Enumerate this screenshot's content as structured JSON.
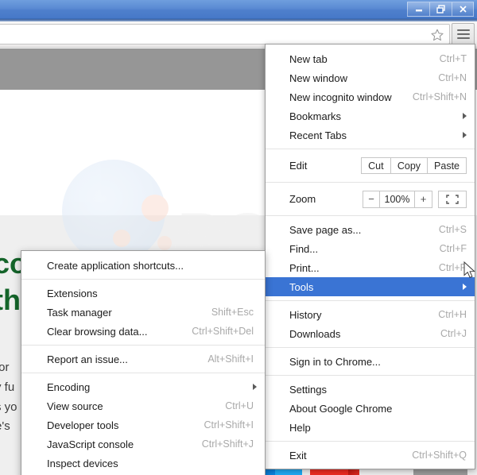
{
  "window": {
    "controls": [
      {
        "name": "minimize",
        "glyph": "minimize-icon"
      },
      {
        "name": "restore",
        "glyph": "restore-icon"
      },
      {
        "name": "close",
        "glyph": "close-icon"
      }
    ]
  },
  "toolbar": {
    "omnibox_value": "",
    "omnibox_placeholder": "",
    "star_icon": "star-icon",
    "menu_button_icon": "hamburger-icon"
  },
  "page": {
    "heading_line1": "co",
    "heading_line2": "th",
    "body_lines": [
      "for",
      "y fu",
      "s yo",
      "e's"
    ],
    "watermark_text": "PCrisk"
  },
  "chrome_menu": {
    "items": [
      {
        "label": "New tab",
        "accel": "Ctrl+T",
        "submenu": false,
        "highlight": false
      },
      {
        "label": "New window",
        "accel": "Ctrl+N",
        "submenu": false,
        "highlight": false
      },
      {
        "label": "New incognito window",
        "accel": "Ctrl+Shift+N",
        "submenu": false,
        "highlight": false
      },
      {
        "label": "Bookmarks",
        "accel": "",
        "submenu": true,
        "highlight": false
      },
      {
        "label": "Recent Tabs",
        "accel": "",
        "submenu": true,
        "highlight": false
      }
    ],
    "edit_row": {
      "label": "Edit",
      "buttons": [
        "Cut",
        "Copy",
        "Paste"
      ]
    },
    "zoom_row": {
      "label": "Zoom",
      "minus": "−",
      "value": "100%",
      "plus": "+",
      "fullscreen_icon": "fullscreen-icon"
    },
    "items2": [
      {
        "label": "Save page as...",
        "accel": "Ctrl+S",
        "submenu": false,
        "highlight": false
      },
      {
        "label": "Find...",
        "accel": "Ctrl+F",
        "submenu": false,
        "highlight": false
      },
      {
        "label": "Print...",
        "accel": "Ctrl+P",
        "submenu": false,
        "highlight": false
      }
    ],
    "tools_item": {
      "label": "Tools",
      "accel": "",
      "submenu": true,
      "highlight": true
    },
    "items3": [
      {
        "label": "History",
        "accel": "Ctrl+H",
        "submenu": false,
        "highlight": false
      },
      {
        "label": "Downloads",
        "accel": "Ctrl+J",
        "submenu": false,
        "highlight": false
      }
    ],
    "items4": [
      {
        "label": "Sign in to Chrome...",
        "accel": "",
        "submenu": false,
        "highlight": false
      }
    ],
    "items5": [
      {
        "label": "Settings",
        "accel": "",
        "submenu": false,
        "highlight": false
      },
      {
        "label": "About Google Chrome",
        "accel": "",
        "submenu": false,
        "highlight": false
      },
      {
        "label": "Help",
        "accel": "",
        "submenu": false,
        "highlight": false
      }
    ],
    "items6": [
      {
        "label": "Exit",
        "accel": "Ctrl+Shift+Q",
        "submenu": false,
        "highlight": false
      }
    ]
  },
  "tools_menu": {
    "group1": [
      {
        "label": "Create application shortcuts...",
        "accel": "",
        "submenu": false
      }
    ],
    "group2": [
      {
        "label": "Extensions",
        "accel": "",
        "submenu": false
      },
      {
        "label": "Task manager",
        "accel": "Shift+Esc",
        "submenu": false
      },
      {
        "label": "Clear browsing data...",
        "accel": "Ctrl+Shift+Del",
        "submenu": false
      }
    ],
    "group3": [
      {
        "label": "Report an issue...",
        "accel": "Alt+Shift+I",
        "submenu": false
      }
    ],
    "group4": [
      {
        "label": "Encoding",
        "accel": "",
        "submenu": true
      },
      {
        "label": "View source",
        "accel": "Ctrl+U",
        "submenu": false
      },
      {
        "label": "Developer tools",
        "accel": "Ctrl+Shift+I",
        "submenu": false
      },
      {
        "label": "JavaScript console",
        "accel": "Ctrl+Shift+J",
        "submenu": false
      },
      {
        "label": "Inspect devices",
        "accel": "",
        "submenu": false
      }
    ]
  },
  "colors": {
    "titlebar": "#4f80cc",
    "highlight": "#3a74d4",
    "accel_text": "#a9a9a9",
    "heading_green": "#14642a"
  }
}
